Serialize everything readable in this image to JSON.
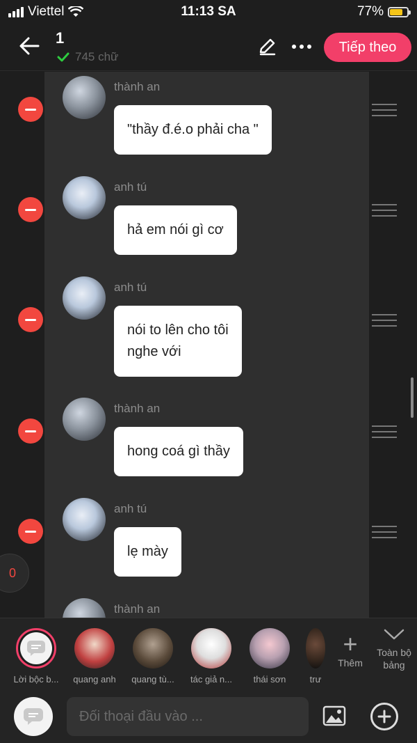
{
  "status_bar": {
    "carrier": "Viettel",
    "time": "11:13 SA",
    "battery_percent_text": "77%",
    "battery_level": 0.77
  },
  "header": {
    "title": "1",
    "word_count": "745 chữ",
    "next_label": "Tiếp theo"
  },
  "colors": {
    "accent": "#f23f69",
    "remove": "#f2473f",
    "check": "#2ecc40",
    "bubble": "#ffffff"
  },
  "messages": [
    {
      "sender": "thành an",
      "text": "\"thầy đ.é.o phải cha \""
    },
    {
      "sender": "anh tú",
      "text": "hả em nói gì cơ"
    },
    {
      "sender": "anh tú",
      "text": "nói to lên cho tôi\nnghe với"
    },
    {
      "sender": "thành an",
      "text": "hong coá gì thầy"
    },
    {
      "sender": "anh tú",
      "text": "lẹ mày"
    },
    {
      "sender": "thành an",
      "text": ""
    }
  ],
  "counter_badge": "0",
  "characters": [
    {
      "name": "Lời bộc b..."
    },
    {
      "name": "quang anh"
    },
    {
      "name": "quang tù..."
    },
    {
      "name": "tác giả n..."
    },
    {
      "name": "thái sơn"
    },
    {
      "name": "trư"
    }
  ],
  "more_characters_label": "Thêm",
  "all_board_label": "Toàn bộ bảng",
  "input": {
    "placeholder": "Đối thoại đầu vào ..."
  },
  "icons": {
    "back": "arrow-left-icon",
    "edit": "pencil-icon",
    "more": "more-icon",
    "check": "check-icon",
    "remove": "minus-icon",
    "drag": "drag-handle-icon",
    "chat": "chat-bubble-icon",
    "image": "image-icon",
    "add": "plus-circle-icon",
    "expand": "chevron-down-icon"
  }
}
